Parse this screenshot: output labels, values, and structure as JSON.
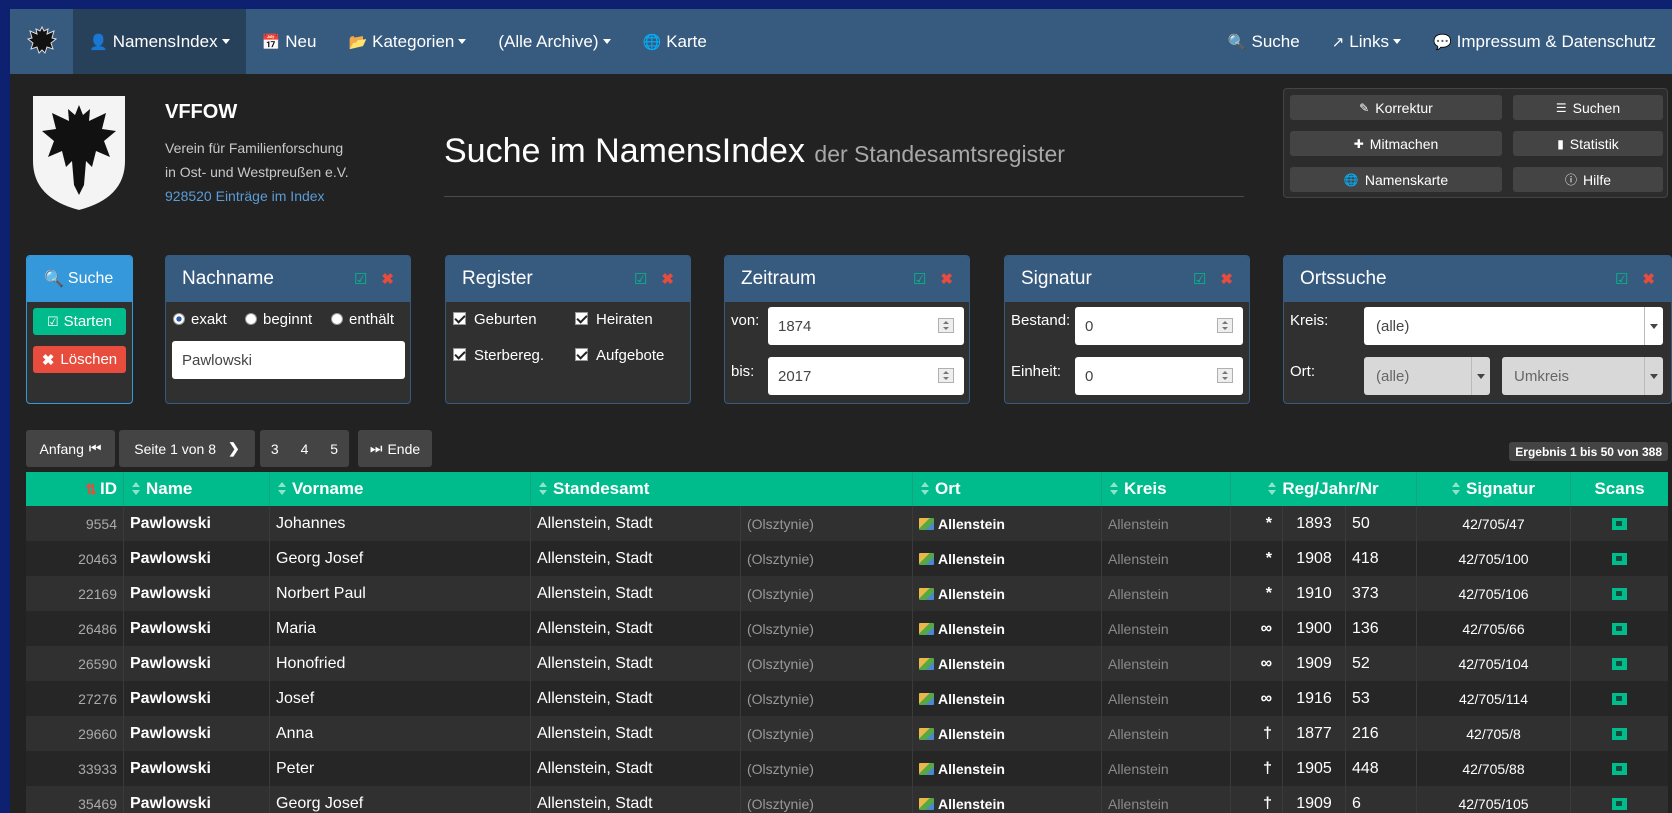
{
  "navbar": {
    "items": [
      {
        "label": "NamensIndex",
        "icon": "user-icon",
        "caret": true
      },
      {
        "label": "Neu",
        "icon": "calendar-icon",
        "caret": false
      },
      {
        "label": "Kategorien",
        "icon": "folder-open-icon",
        "caret": true
      },
      {
        "label": "(Alle Archive)",
        "icon": "",
        "caret": true
      },
      {
        "label": "Karte",
        "icon": "globe-icon",
        "caret": false
      }
    ],
    "right": [
      {
        "label": "Suche",
        "icon": "search-icon"
      },
      {
        "label": "Links",
        "icon": "external-link-icon"
      },
      {
        "label": "Impressum & Datenschutz",
        "icon": "comment-icon"
      }
    ]
  },
  "site": {
    "title": "VFFOW",
    "sub1": "Verein für Familienforschung",
    "sub2": "in Ost- und Westpreußen e.V.",
    "count": "928520 Einträge im Index"
  },
  "heading": {
    "main": "Suche im NamensIndex",
    "small": "der Standesamtsregister"
  },
  "quick": {
    "korrektur": "Korrektur",
    "suchen": "Suchen",
    "mitmachen": "Mitmachen",
    "statistik": "Statistik",
    "namenskarte": "Namenskarte",
    "hilfe": "Hilfe"
  },
  "search_panel": {
    "title": "Suche",
    "start": "Starten",
    "clear": "Löschen"
  },
  "nachname": {
    "title": "Nachname",
    "modes": [
      "exakt",
      "beginnt",
      "enthält"
    ],
    "selected_mode": "exakt",
    "value": "Pawlowski"
  },
  "register": {
    "title": "Register",
    "options": [
      {
        "label": "Geburten",
        "checked": true
      },
      {
        "label": "Heiraten",
        "checked": true
      },
      {
        "label": "Sterbereg.",
        "checked": true
      },
      {
        "label": "Aufgebote",
        "checked": true
      }
    ]
  },
  "zeitraum": {
    "title": "Zeitraum",
    "from_label": "von:",
    "from": "1874",
    "to_label": "bis:",
    "to": "2017"
  },
  "signatur": {
    "title": "Signatur",
    "bestand_label": "Bestand:",
    "bestand": "0",
    "einheit_label": "Einheit:",
    "einheit": "0"
  },
  "ortssuche": {
    "title": "Ortssuche",
    "kreis_label": "Kreis:",
    "kreis": "(alle)",
    "ort_label": "Ort:",
    "ort": "(alle)",
    "umkreis": "Umkreis"
  },
  "pager": {
    "first": "Anfang",
    "page": "Seite 1 von 8",
    "pages": [
      "3",
      "4",
      "5"
    ],
    "last": "Ende",
    "result": "Ergebnis 1 bis 50 von 388"
  },
  "table": {
    "headers": [
      "ID",
      "Name",
      "Vorname",
      "Standesamt",
      "Ort",
      "Kreis",
      "Reg/Jahr/Nr",
      "Signatur",
      "Scans"
    ],
    "rows": [
      {
        "id": "9554",
        "name": "Pawlowski",
        "vorname": "Johannes",
        "standesamt": "Allenstein, Stadt",
        "pl": "(Olsztynie)",
        "ort": "Allenstein",
        "kreis": "Allenstein",
        "reg": "*",
        "jahr": "1893",
        "nr": "50",
        "signatur": "42/705/47"
      },
      {
        "id": "20463",
        "name": "Pawlowski",
        "vorname": "Georg Josef",
        "standesamt": "Allenstein, Stadt",
        "pl": "(Olsztynie)",
        "ort": "Allenstein",
        "kreis": "Allenstein",
        "reg": "*",
        "jahr": "1908",
        "nr": "418",
        "signatur": "42/705/100"
      },
      {
        "id": "22169",
        "name": "Pawlowski",
        "vorname": "Norbert Paul",
        "standesamt": "Allenstein, Stadt",
        "pl": "(Olsztynie)",
        "ort": "Allenstein",
        "kreis": "Allenstein",
        "reg": "*",
        "jahr": "1910",
        "nr": "373",
        "signatur": "42/705/106"
      },
      {
        "id": "26486",
        "name": "Pawlowski",
        "vorname": "Maria",
        "standesamt": "Allenstein, Stadt",
        "pl": "(Olsztynie)",
        "ort": "Allenstein",
        "kreis": "Allenstein",
        "reg": "∞",
        "jahr": "1900",
        "nr": "136",
        "signatur": "42/705/66"
      },
      {
        "id": "26590",
        "name": "Pawlowski",
        "vorname": "Honofried",
        "standesamt": "Allenstein, Stadt",
        "pl": "(Olsztynie)",
        "ort": "Allenstein",
        "kreis": "Allenstein",
        "reg": "∞",
        "jahr": "1909",
        "nr": "52",
        "signatur": "42/705/104"
      },
      {
        "id": "27276",
        "name": "Pawlowski",
        "vorname": "Josef",
        "standesamt": "Allenstein, Stadt",
        "pl": "(Olsztynie)",
        "ort": "Allenstein",
        "kreis": "Allenstein",
        "reg": "∞",
        "jahr": "1916",
        "nr": "53",
        "signatur": "42/705/114"
      },
      {
        "id": "29660",
        "name": "Pawlowski",
        "vorname": "Anna",
        "standesamt": "Allenstein, Stadt",
        "pl": "(Olsztynie)",
        "ort": "Allenstein",
        "kreis": "Allenstein",
        "reg": "†",
        "jahr": "1877",
        "nr": "216",
        "signatur": "42/705/8"
      },
      {
        "id": "33933",
        "name": "Pawlowski",
        "vorname": "Peter",
        "standesamt": "Allenstein, Stadt",
        "pl": "(Olsztynie)",
        "ort": "Allenstein",
        "kreis": "Allenstein",
        "reg": "†",
        "jahr": "1905",
        "nr": "448",
        "signatur": "42/705/88"
      },
      {
        "id": "35469",
        "name": "Pawlowski",
        "vorname": "Georg Josef",
        "standesamt": "Allenstein, Stadt",
        "pl": "(Olsztynie)",
        "ort": "Allenstein",
        "kreis": "Allenstein",
        "reg": "†",
        "jahr": "1909",
        "nr": "6",
        "signatur": "42/705/105"
      }
    ]
  },
  "colors": {
    "navbar": "#375a7f",
    "accent": "#00bc8c",
    "danger": "#e74c3c",
    "background": "#222222"
  }
}
